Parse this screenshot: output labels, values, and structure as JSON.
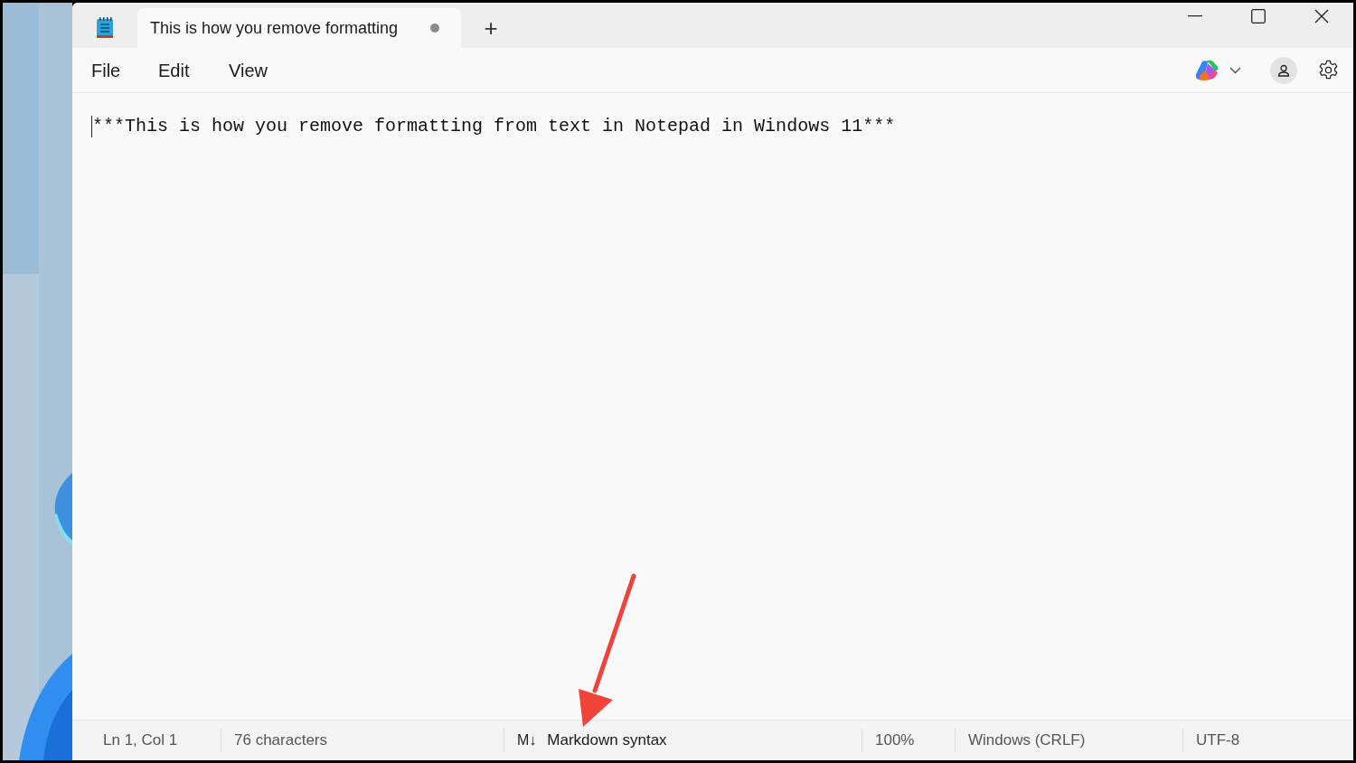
{
  "window": {
    "tabs": [
      {
        "title": "This is how you remove formatting",
        "unsaved": true,
        "selected": true
      }
    ],
    "new_tab": "+"
  },
  "menu": [
    {
      "label": "File"
    },
    {
      "label": "Edit"
    },
    {
      "label": "View"
    }
  ],
  "editor": {
    "text": "***This is how you remove formatting from text in Notepad in Windows 11***"
  },
  "status_bar": [
    {
      "kind": "text",
      "text": "Ln 1, Col 1"
    },
    {
      "kind": "text",
      "text": "76 characters"
    },
    {
      "kind": "format",
      "icon": "M↓",
      "text": "Markdown syntax"
    },
    {
      "kind": "text",
      "text": "100%"
    },
    {
      "kind": "text",
      "text": "Windows (CRLF)"
    },
    {
      "kind": "text",
      "text": "UTF-8"
    }
  ]
}
